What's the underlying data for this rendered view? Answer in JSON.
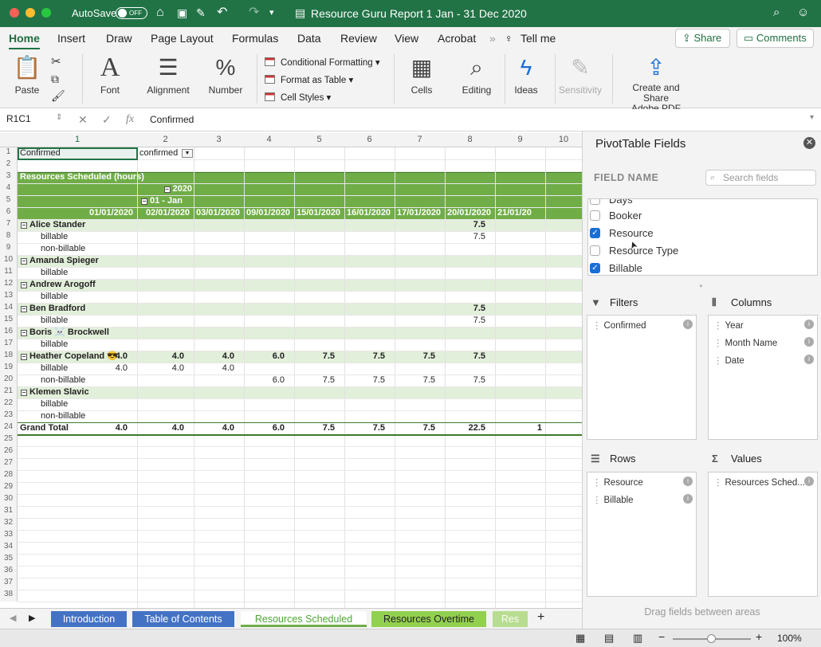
{
  "titlebar": {
    "autosave": "AutoSave",
    "toggle": "OFF",
    "doc_title": "Resource Guru Report 1 Jan - 31 Dec 2020"
  },
  "menu": {
    "items": [
      "Home",
      "Insert",
      "Draw",
      "Page Layout",
      "Formulas",
      "Data",
      "Review",
      "View",
      "Acrobat"
    ],
    "tell_me": "Tell me",
    "share": "Share",
    "comments": "Comments"
  },
  "ribbon": {
    "paste": "Paste",
    "font": "Font",
    "alignment": "Alignment",
    "number": "Number",
    "conditional_formatting": "Conditional Formatting",
    "format_as_table": "Format as Table",
    "cell_styles": "Cell Styles",
    "cells": "Cells",
    "editing": "Editing",
    "ideas": "Ideas",
    "sensitivity": "Sensitivity",
    "create_share_line1": "Create and Share",
    "create_share_line2": "Adobe PDF"
  },
  "formula": {
    "name_box": "R1C1",
    "value": "Confirmed"
  },
  "grid": {
    "col_headers": [
      "1",
      "2",
      "3",
      "4",
      "5",
      "6",
      "7",
      "8",
      "9",
      "10"
    ],
    "row_numbers": [
      "1",
      "2",
      "3",
      "4",
      "5",
      "6",
      "7",
      "8",
      "9",
      "10",
      "11",
      "12",
      "13",
      "14",
      "15",
      "16",
      "17",
      "18",
      "19",
      "20",
      "21",
      "22",
      "23",
      "24",
      "25",
      "26",
      "27",
      "28",
      "29",
      "30",
      "31",
      "32",
      "33",
      "34",
      "35",
      "36",
      "37",
      "38"
    ],
    "filter_label": "Confirmed",
    "filter_value": "confirmed",
    "pivot_title": "Resources Scheduled (hours)",
    "year": "2020",
    "month": "01 - Jan",
    "dates": [
      "01/01/2020",
      "02/01/2020",
      "03/01/2020",
      "09/01/2020",
      "15/01/2020",
      "16/01/2020",
      "17/01/2020",
      "20/01/2020",
      "21/01/20"
    ],
    "rows": [
      {
        "label": "Alice Stander",
        "level": "resource",
        "values": [
          "",
          "",
          "",
          "",
          "",
          "",
          "",
          "7.5",
          ""
        ]
      },
      {
        "label": "billable",
        "level": "sub",
        "values": [
          "",
          "",
          "",
          "",
          "",
          "",
          "",
          "7.5",
          ""
        ]
      },
      {
        "label": "non-billable",
        "level": "sub",
        "values": [
          "",
          "",
          "",
          "",
          "",
          "",
          "",
          "",
          ""
        ]
      },
      {
        "label": "Amanda Spieger",
        "level": "resource",
        "values": [
          "",
          "",
          "",
          "",
          "",
          "",
          "",
          "",
          ""
        ]
      },
      {
        "label": "billable",
        "level": "sub",
        "values": [
          "",
          "",
          "",
          "",
          "",
          "",
          "",
          "",
          ""
        ]
      },
      {
        "label": "Andrew Arogoff",
        "level": "resource",
        "values": [
          "",
          "",
          "",
          "",
          "",
          "",
          "",
          "",
          ""
        ]
      },
      {
        "label": "billable",
        "level": "sub",
        "values": [
          "",
          "",
          "",
          "",
          "",
          "",
          "",
          "",
          ""
        ]
      },
      {
        "label": "Ben Bradford",
        "level": "resource",
        "values": [
          "",
          "",
          "",
          "",
          "",
          "",
          "",
          "7.5",
          ""
        ]
      },
      {
        "label": "billable",
        "level": "sub",
        "values": [
          "",
          "",
          "",
          "",
          "",
          "",
          "",
          "7.5",
          ""
        ]
      },
      {
        "label": "Boris ☠️ Brockwell",
        "level": "resource",
        "values": [
          "",
          "",
          "",
          "",
          "",
          "",
          "",
          "",
          ""
        ]
      },
      {
        "label": "billable",
        "level": "sub",
        "values": [
          "",
          "",
          "",
          "",
          "",
          "",
          "",
          "",
          ""
        ]
      },
      {
        "label": "Heather Copeland 😎",
        "level": "resource",
        "values": [
          "4.0",
          "4.0",
          "4.0",
          "6.0",
          "7.5",
          "7.5",
          "7.5",
          "7.5",
          ""
        ]
      },
      {
        "label": "billable",
        "level": "sub",
        "values": [
          "4.0",
          "4.0",
          "4.0",
          "",
          "",
          "",
          "",
          "",
          ""
        ]
      },
      {
        "label": "non-billable",
        "level": "sub",
        "values": [
          "",
          "",
          "",
          "6.0",
          "7.5",
          "7.5",
          "7.5",
          "7.5",
          ""
        ]
      },
      {
        "label": "Klemen Slavic",
        "level": "resource",
        "values": [
          "",
          "",
          "",
          "",
          "",
          "",
          "",
          "",
          ""
        ]
      },
      {
        "label": "billable",
        "level": "sub",
        "values": [
          "",
          "",
          "",
          "",
          "",
          "",
          "",
          "",
          ""
        ]
      },
      {
        "label": "non-billable",
        "level": "sub",
        "values": [
          "",
          "",
          "",
          "",
          "",
          "",
          "",
          "",
          ""
        ]
      },
      {
        "label": "Grand Total",
        "level": "total",
        "values": [
          "4.0",
          "4.0",
          "4.0",
          "6.0",
          "7.5",
          "7.5",
          "7.5",
          "22.5",
          "1"
        ]
      }
    ]
  },
  "sheet_tabs": [
    "Introduction",
    "Table of Contents",
    "Resources Scheduled",
    "Resources Overtime",
    "Res"
  ],
  "status": {
    "zoom": "100%"
  },
  "pivot_pane": {
    "title": "PivotTable Fields",
    "field_name": "FIELD NAME",
    "search_placeholder": "Search fields",
    "fields": [
      {
        "label": "Days",
        "checked": false
      },
      {
        "label": "Booker",
        "checked": false
      },
      {
        "label": "Resource",
        "checked": true
      },
      {
        "label": "Resource Type",
        "checked": false
      },
      {
        "label": "Billable",
        "checked": true
      }
    ],
    "filters_title": "Filters",
    "filters": [
      "Confirmed"
    ],
    "columns_title": "Columns",
    "columns": [
      "Year",
      "Month Name",
      "Date"
    ],
    "rows_title": "Rows",
    "rows": [
      "Resource",
      "Billable"
    ],
    "values_title": "Values",
    "values": [
      "Resources Sched..."
    ],
    "drag_hint": "Drag fields between areas"
  }
}
